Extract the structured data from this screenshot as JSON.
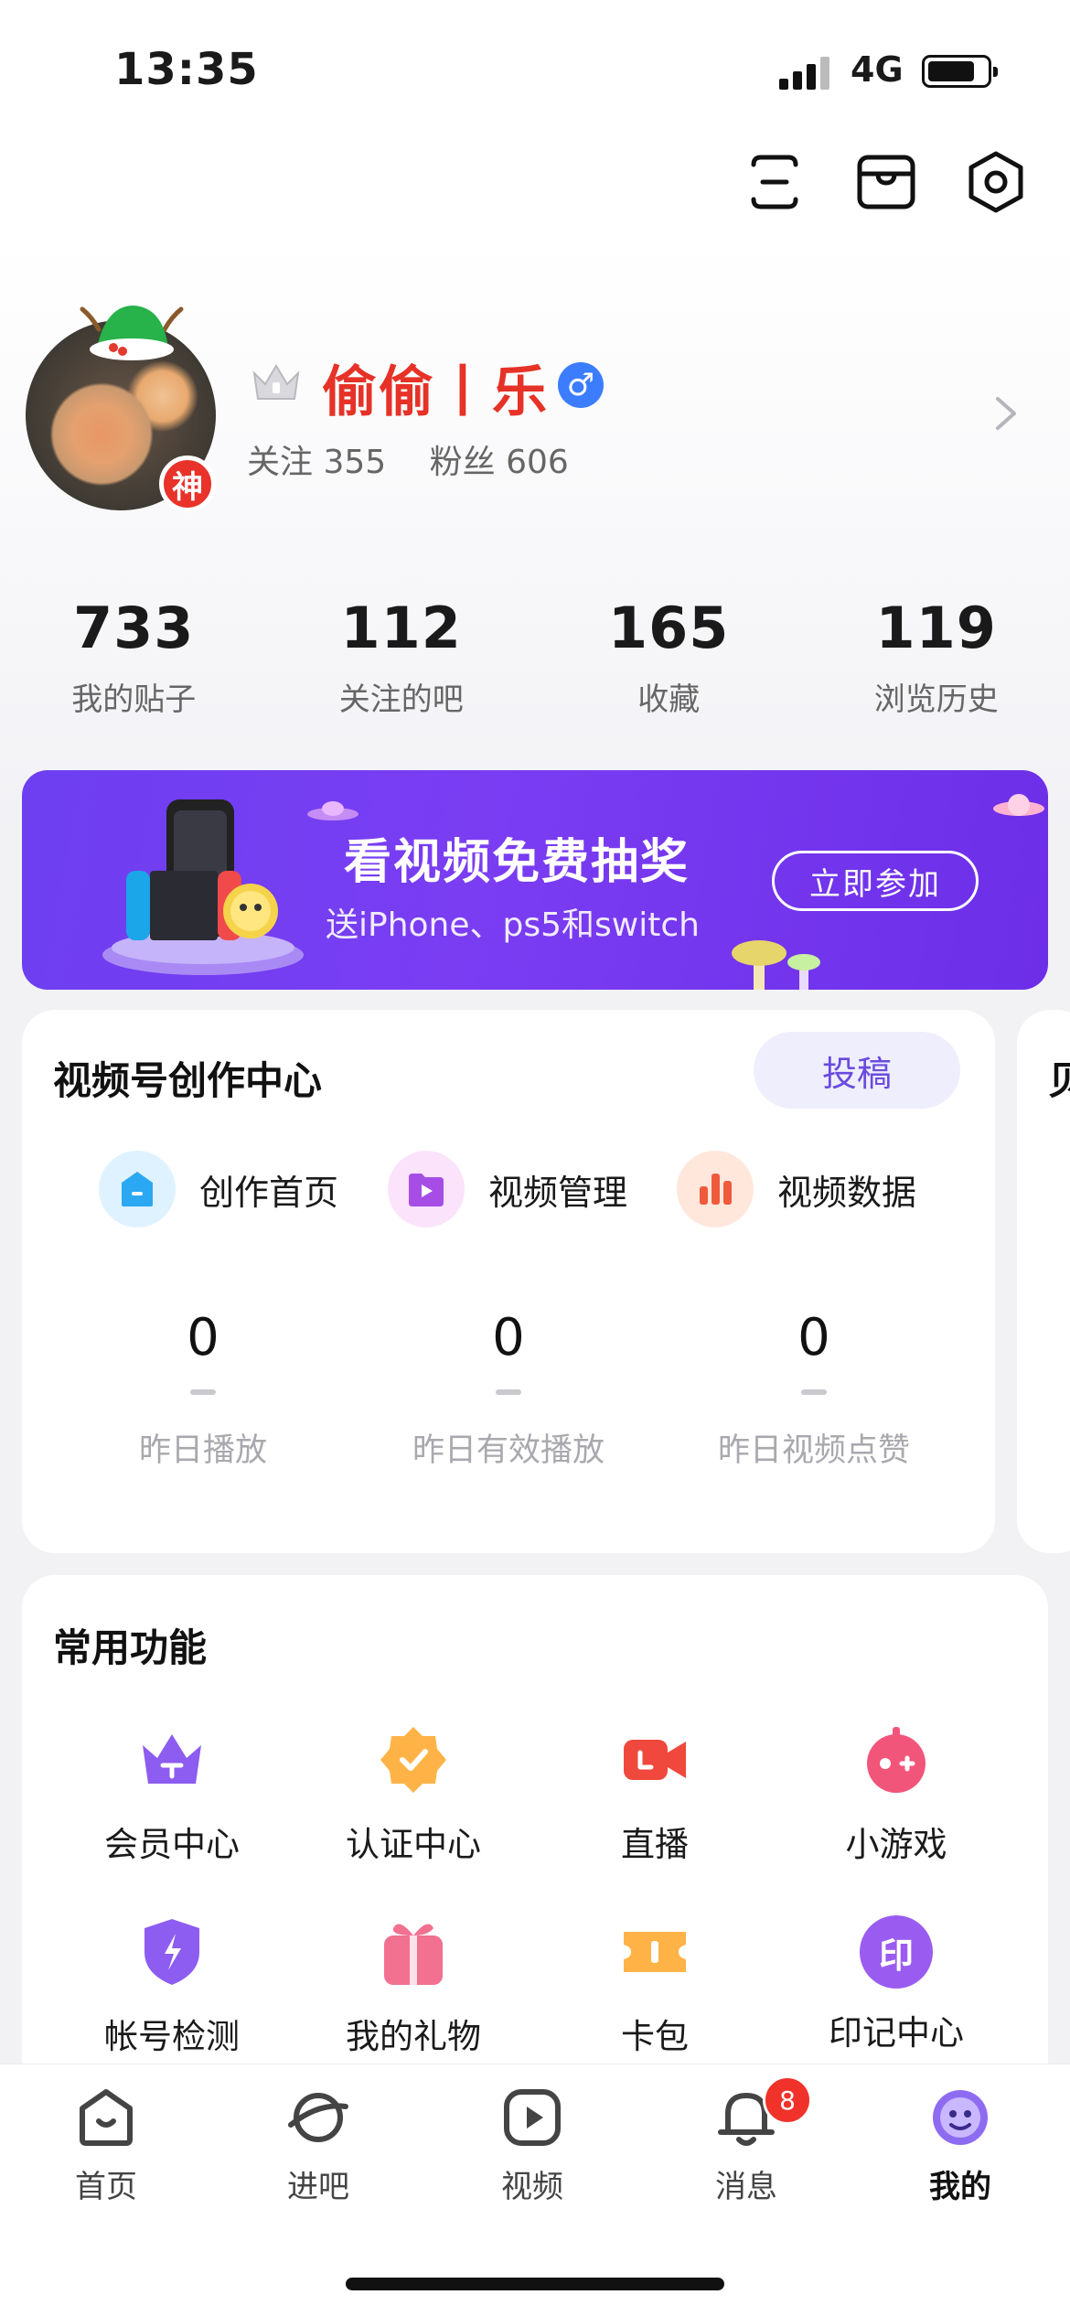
{
  "status_bar": {
    "time": "13:35",
    "network": "4G"
  },
  "profile": {
    "badge": "神",
    "username": "偷偷丨乐",
    "gender_symbol": "♂",
    "following_label": "关注 355",
    "followers_label": "粉丝 606"
  },
  "stats": [
    {
      "value": "733",
      "label": "我的贴子"
    },
    {
      "value": "112",
      "label": "关注的吧"
    },
    {
      "value": "165",
      "label": "收藏"
    },
    {
      "value": "119",
      "label": "浏览历史"
    }
  ],
  "banner": {
    "title": "看视频免费抽奖",
    "subtitle": "送iPhone、ps5和switch",
    "button": "立即参加"
  },
  "creator_center": {
    "title": "视频号创作中心",
    "submit_button": "投稿",
    "quick_links": [
      {
        "label": "创作首页",
        "icon": "home-icon",
        "color": "#2aa8f2"
      },
      {
        "label": "视频管理",
        "icon": "video-folder-icon",
        "color": "#a64de6"
      },
      {
        "label": "视频数据",
        "icon": "bar-chart-icon",
        "color": "#f05a3c"
      }
    ],
    "metrics": [
      {
        "value": "0",
        "label": "昨日播放"
      },
      {
        "value": "0",
        "label": "昨日有效播放"
      },
      {
        "value": "0",
        "label": "昨日视频点赞"
      }
    ],
    "next_card_peek": "贝"
  },
  "common_functions": {
    "title": "常用功能",
    "items": [
      {
        "label": "会员中心",
        "icon": "crown-icon",
        "color": "#8d5cf0"
      },
      {
        "label": "认证中心",
        "icon": "verified-badge-icon",
        "color": "#ffb347"
      },
      {
        "label": "直播",
        "icon": "live-camera-icon",
        "color": "#f0483c"
      },
      {
        "label": "小游戏",
        "icon": "game-controller-icon",
        "color": "#f2557a"
      },
      {
        "label": "帐号检测",
        "icon": "shield-icon",
        "color": "#8d5cf0"
      },
      {
        "label": "我的礼物",
        "icon": "gift-icon",
        "color": "#f27090"
      },
      {
        "label": "卡包",
        "icon": "ticket-icon",
        "color": "#ffb347"
      },
      {
        "label": "印记中心",
        "icon": "seal-icon",
        "color": "#9a5cf0",
        "glyph": "印"
      }
    ]
  },
  "tab_bar": [
    {
      "label": "首页",
      "icon": "home-tab-icon"
    },
    {
      "label": "进吧",
      "icon": "planet-icon"
    },
    {
      "label": "视频",
      "icon": "play-icon"
    },
    {
      "label": "消息",
      "icon": "bell-icon",
      "badge": "8"
    },
    {
      "label": "我的",
      "icon": "smile-face-icon",
      "active": true
    }
  ]
}
